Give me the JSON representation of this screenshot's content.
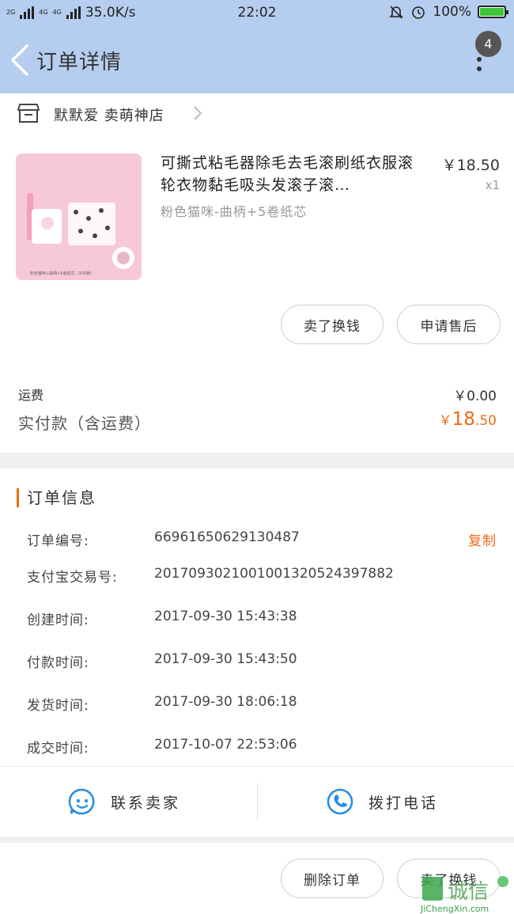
{
  "status_bar": {
    "network_1": "2G",
    "network_2": "4G",
    "network_3": "4G",
    "speed": "35.0K/s",
    "time": "22:02",
    "battery": "100%",
    "battery_level": 1.0
  },
  "header": {
    "title": "订单详情",
    "badge": "4"
  },
  "shop": {
    "name": "默默爱 卖萌神店"
  },
  "product": {
    "title": "可撕式粘毛器除毛去毛滚刷纸衣服滚轮衣物黏毛吸头发滚子滚…",
    "spec": "粉色猫咪-曲柄+5卷纸芯",
    "price": "￥18.50",
    "qty": "x1",
    "image_caption": "粉色猫咪+曲柄+5卷纸芯（300撕）"
  },
  "actions": {
    "resell": "卖了换钱",
    "after_sale": "申请售后"
  },
  "fees": {
    "shipping_label": "运费",
    "shipping_value": "￥0.00",
    "paid_label": "实付款（含运费）",
    "paid_currency": "￥",
    "paid_int": "18",
    "paid_dec": ".50"
  },
  "order_info": {
    "title": "订单信息",
    "copy_label": "复制",
    "rows": [
      {
        "label": "订单编号:",
        "value": "66961650629130487"
      },
      {
        "label": "支付宝交易号:",
        "value": "2017093021001001320524397882"
      },
      {
        "label": "创建时间:",
        "value": "2017-09-30 15:43:38"
      },
      {
        "label": "付款时间:",
        "value": "2017-09-30 15:43:50"
      },
      {
        "label": "发货时间:",
        "value": "2017-09-30 18:06:18"
      },
      {
        "label": "成交时间:",
        "value": "2017-10-07 22:53:06"
      }
    ]
  },
  "contact": {
    "seller": "联系卖家",
    "phone": "拨打电话"
  },
  "bottom_actions": {
    "delete": "删除订单",
    "resell": "卖了换钱"
  },
  "watermark": {
    "text": "诚信",
    "url": "JiChengXin.com"
  },
  "colors": {
    "header_bg": "#b5cdee",
    "accent": "#f06a15",
    "icon_blue": "#2a8fe0"
  }
}
